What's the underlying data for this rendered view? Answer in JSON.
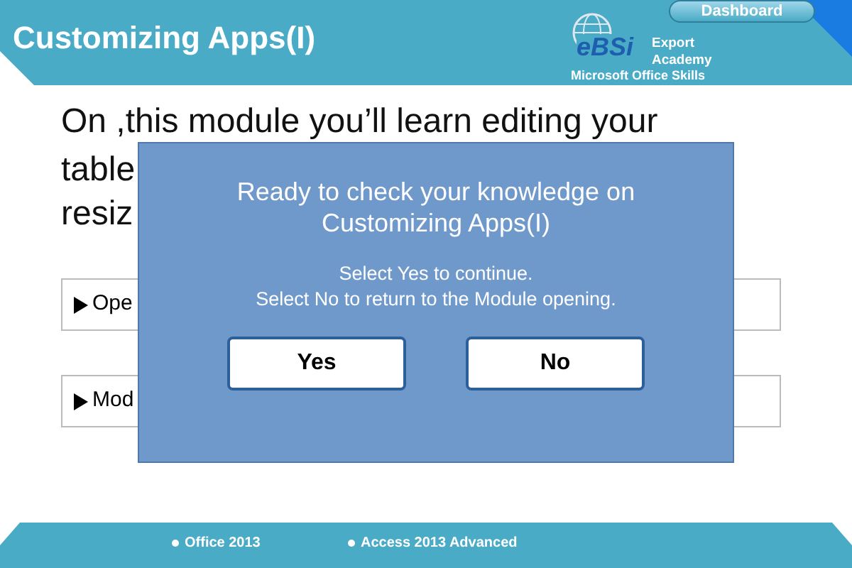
{
  "header": {
    "title": "Customizing Apps(I)",
    "dashboard_button": "Dashboard",
    "logo": {
      "mark": "eBSi",
      "line_1": "Export",
      "line_2": "Academy",
      "tagline": "Microsoft Office Skills"
    }
  },
  "intro": {
    "line_1": "On ,this module you’ll learn editing your",
    "line_2": "table",
    "line_3": "resiz"
  },
  "topics": [
    {
      "label": "Ope"
    },
    {
      "label": "Mod"
    }
  ],
  "dialog": {
    "title_1": "Ready to check your knowledge on",
    "title_2": "Customizing Apps(I)",
    "message_1": "Select Yes to continue.",
    "message_2": "Select No to return to the Module opening.",
    "buttons": [
      {
        "label": "Yes"
      },
      {
        "label": "No"
      }
    ]
  },
  "footer": {
    "items": [
      "Office 2013",
      "Access 2013 Advanced"
    ]
  }
}
